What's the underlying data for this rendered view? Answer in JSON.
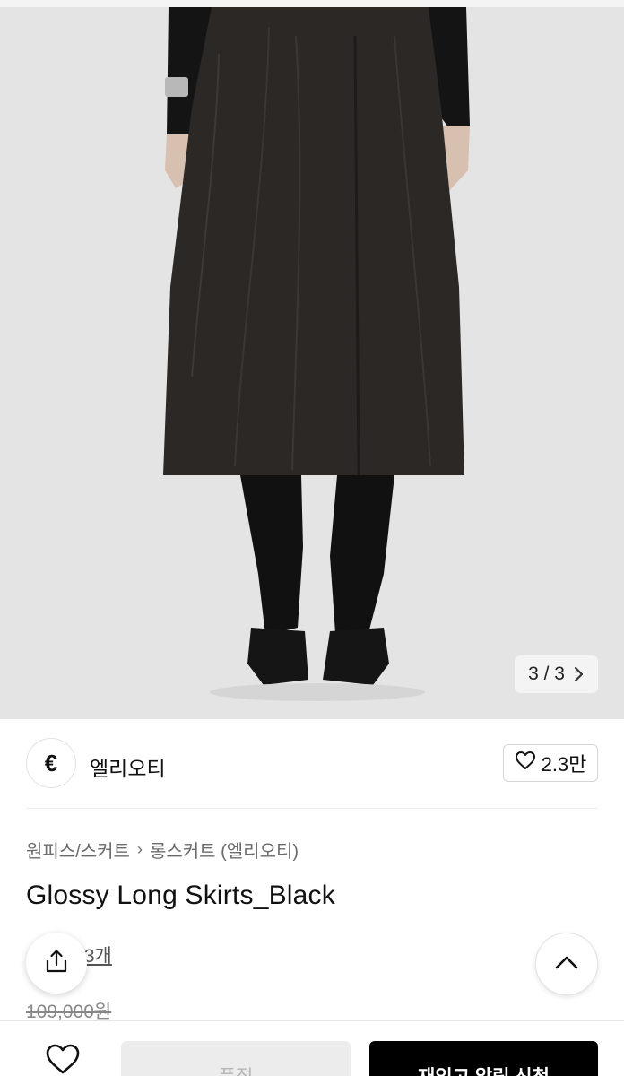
{
  "gallery": {
    "pager_text": "3 / 3",
    "pager_next_icon": "chevron-right-icon",
    "colors": {
      "backdrop": "#e4e4e4",
      "skirt": "#2b2826",
      "tights": "#111111"
    }
  },
  "brand": {
    "logo_letter": "€",
    "name": "엘리오티",
    "like_icon": "heart-outline-icon",
    "like_count": "2.3만"
  },
  "product": {
    "breadcrumb": {
      "category": "원피스/스커트",
      "separator": "›",
      "subcategory": "롱스커트 (엘리오티)"
    },
    "title": "Glossy Long Skirts_Black",
    "review_stars": "★",
    "review_text": "후기 3개",
    "original_price": "109,000원"
  },
  "actions": {
    "share_icon": "share-icon",
    "scroll_top_icon": "chevron-up-icon",
    "wishlist_icon": "heart-outline-icon",
    "soldout_label": "품절",
    "restock_label": "재입고 알림 신청"
  }
}
